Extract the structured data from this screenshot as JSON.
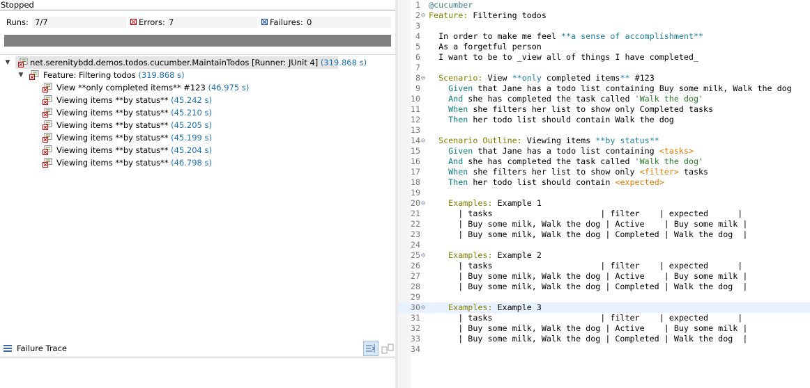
{
  "status": "Stopped",
  "counters": {
    "runs_label": "Runs:",
    "runs_value": "7/7",
    "errors_label": "Errors:",
    "errors_value": "7",
    "failures_label": "Failures:",
    "failures_value": "0"
  },
  "tree": {
    "root": {
      "label": "net.serenitybdd.demos.todos.cucumber.MaintainTodos [Runner: JUnit 4]",
      "time": "(319.868 s)"
    },
    "feature": {
      "label": "Feature: Filtering todos",
      "time": "(319.868 s)"
    },
    "tests": [
      {
        "label": "View **only completed items** #123",
        "time": "(46.975 s)"
      },
      {
        "label": "Viewing items **by status**",
        "time": "(45.242 s)"
      },
      {
        "label": "Viewing items **by status**",
        "time": "(45.210 s)"
      },
      {
        "label": "Viewing items **by status**",
        "time": "(45.205 s)"
      },
      {
        "label": "Viewing items **by status**",
        "time": "(45.199 s)"
      },
      {
        "label": "Viewing items **by status**",
        "time": "(45.204 s)"
      },
      {
        "label": "Viewing items **by status**",
        "time": "(46.798 s)"
      }
    ]
  },
  "failure_trace": {
    "label": "Failure Trace"
  },
  "editor": {
    "highlighted_line": 30,
    "lines": [
      {
        "n": "1",
        "fold": "",
        "segs": [
          [
            "tag",
            "@cucumber"
          ]
        ]
      },
      {
        "n": "2",
        "fold": "⊖",
        "segs": [
          [
            "kw",
            "Feature:"
          ],
          [
            "",
            " Filtering todos"
          ]
        ]
      },
      {
        "n": "3",
        "fold": "",
        "segs": []
      },
      {
        "n": "4",
        "fold": "",
        "segs": [
          [
            "",
            "  In order to make me feel "
          ],
          [
            "md",
            "**a sense of accomplishment**"
          ]
        ]
      },
      {
        "n": "5",
        "fold": "",
        "segs": [
          [
            "",
            "  As a forgetful person"
          ]
        ]
      },
      {
        "n": "6",
        "fold": "",
        "segs": [
          [
            "",
            "  I want to be to _view all of things I have completed_"
          ]
        ]
      },
      {
        "n": "7",
        "fold": "",
        "segs": []
      },
      {
        "n": "8",
        "fold": "⊖",
        "segs": [
          [
            "kw",
            "  Scenario:"
          ],
          [
            "",
            " View "
          ],
          [
            "md",
            "**only"
          ],
          [
            "",
            " completed items"
          ],
          [
            "md",
            "**"
          ],
          [
            "",
            " #123"
          ]
        ]
      },
      {
        "n": "9",
        "fold": "",
        "segs": [
          [
            "step",
            "    Given"
          ],
          [
            "",
            " that Jane has a todo list containing Buy some milk, Walk the dog"
          ]
        ]
      },
      {
        "n": "10",
        "fold": "",
        "segs": [
          [
            "step",
            "    And"
          ],
          [
            "",
            " she has completed the task called "
          ],
          [
            "str",
            "'Walk the dog'"
          ]
        ]
      },
      {
        "n": "11",
        "fold": "",
        "segs": [
          [
            "step",
            "    When"
          ],
          [
            "",
            " she filters her list to show only Completed tasks"
          ]
        ]
      },
      {
        "n": "12",
        "fold": "",
        "segs": [
          [
            "step",
            "    Then"
          ],
          [
            "",
            " her todo list should contain Walk the dog"
          ]
        ]
      },
      {
        "n": "13",
        "fold": "",
        "segs": []
      },
      {
        "n": "14",
        "fold": "⊖",
        "segs": [
          [
            "kw",
            "  Scenario Outline:"
          ],
          [
            "",
            " Viewing items "
          ],
          [
            "md",
            "**by status**"
          ]
        ]
      },
      {
        "n": "15",
        "fold": "",
        "segs": [
          [
            "step",
            "    Given"
          ],
          [
            "",
            " that Jane has a todo list containing "
          ],
          [
            "ph",
            "<tasks>"
          ]
        ]
      },
      {
        "n": "16",
        "fold": "",
        "segs": [
          [
            "step",
            "    And"
          ],
          [
            "",
            " she has completed the task called "
          ],
          [
            "str",
            "'Walk the dog'"
          ]
        ]
      },
      {
        "n": "17",
        "fold": "",
        "segs": [
          [
            "step",
            "    When"
          ],
          [
            "",
            " she filters her list to show only "
          ],
          [
            "ph",
            "<filter>"
          ],
          [
            "",
            " tasks"
          ]
        ]
      },
      {
        "n": "18",
        "fold": "",
        "segs": [
          [
            "step",
            "    Then"
          ],
          [
            "",
            " her todo list should contain "
          ],
          [
            "ph",
            "<expected>"
          ]
        ]
      },
      {
        "n": "19",
        "fold": "",
        "segs": []
      },
      {
        "n": "20",
        "fold": "⊖",
        "segs": [
          [
            "kw",
            "    Examples:"
          ],
          [
            "",
            " Example 1"
          ]
        ]
      },
      {
        "n": "21",
        "fold": "",
        "segs": [
          [
            "",
            "      | tasks                      | filter    | expected      |"
          ]
        ]
      },
      {
        "n": "22",
        "fold": "",
        "segs": [
          [
            "",
            "      | Buy some milk, Walk the dog | Active    | Buy some milk |"
          ]
        ]
      },
      {
        "n": "23",
        "fold": "",
        "segs": [
          [
            "",
            "      | Buy some milk, Walk the dog | Completed | Walk the dog  |"
          ]
        ]
      },
      {
        "n": "24",
        "fold": "",
        "segs": []
      },
      {
        "n": "25",
        "fold": "⊖",
        "segs": [
          [
            "kw",
            "    Examples:"
          ],
          [
            "",
            " Example 2"
          ]
        ]
      },
      {
        "n": "26",
        "fold": "",
        "segs": [
          [
            "",
            "      | tasks                      | filter    | expected      |"
          ]
        ]
      },
      {
        "n": "27",
        "fold": "",
        "segs": [
          [
            "",
            "      | Buy some milk, Walk the dog | Active    | Buy some milk |"
          ]
        ]
      },
      {
        "n": "28",
        "fold": "",
        "segs": [
          [
            "",
            "      | Buy some milk, Walk the dog | Completed | Walk the dog  |"
          ]
        ]
      },
      {
        "n": "29",
        "fold": "",
        "segs": []
      },
      {
        "n": "30",
        "fold": "⊖",
        "segs": [
          [
            "kw",
            "    Examples:"
          ],
          [
            "",
            " Example 3"
          ]
        ]
      },
      {
        "n": "31",
        "fold": "",
        "segs": [
          [
            "",
            "      | tasks                      | filter    | expected      |"
          ]
        ]
      },
      {
        "n": "32",
        "fold": "",
        "segs": [
          [
            "",
            "      | Buy some milk, Walk the dog | Active    | Buy some milk |"
          ]
        ]
      },
      {
        "n": "33",
        "fold": "",
        "segs": [
          [
            "",
            "      | Buy some milk, Walk the dog | Completed | Walk the dog  |"
          ]
        ]
      },
      {
        "n": "34",
        "fold": "",
        "segs": []
      }
    ]
  }
}
